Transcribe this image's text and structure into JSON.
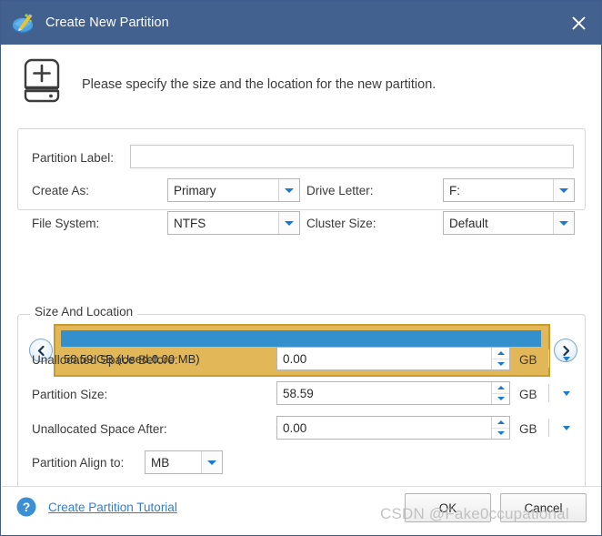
{
  "window": {
    "title": "Create New Partition",
    "title_icon": "partition-wizard-icon",
    "close_icon": "close-icon",
    "titlebar_color": "#43618E"
  },
  "banner": {
    "icon": "hard-drive-plus-icon",
    "message": "Please specify the size and the location for the new partition."
  },
  "form": {
    "partition_label": {
      "label": "Partition Label:",
      "value": "",
      "placeholder": ""
    },
    "create_as": {
      "label": "Create As:",
      "value": "Primary"
    },
    "drive_letter": {
      "label": "Drive Letter:",
      "value": "F:"
    },
    "file_system": {
      "label": "File System:",
      "value": "NTFS"
    },
    "cluster_size": {
      "label": "Cluster Size:",
      "value": "Default"
    }
  },
  "size_and_location": {
    "group_title": "Size And Location",
    "prev_icon": "chevron-left-icon",
    "next_icon": "chevron-right-icon",
    "partition": {
      "caption": "58.59 GB (Used:0.00 MB)",
      "fill_color": "#3490CD",
      "block_color": "#E2B757",
      "border_color": "#C99A2E",
      "used_percent": 0
    },
    "unallocated_before": {
      "label": "Unallocated Space Before:",
      "value": "0.00",
      "unit": "GB"
    },
    "partition_size": {
      "label": "Partition Size:",
      "value": "58.59",
      "unit": "GB"
    },
    "unallocated_after": {
      "label": "Unallocated Space After:",
      "value": "0.00",
      "unit": "GB"
    },
    "partition_align": {
      "label": "Partition Align to:",
      "value": "MB"
    }
  },
  "footer": {
    "help_icon": "help-question-icon",
    "tutorial_link": "Create Partition Tutorial",
    "ok_label": "OK",
    "cancel_label": "Cancel"
  },
  "watermark": {
    "text": "CSDN @Fake0ccupational"
  }
}
